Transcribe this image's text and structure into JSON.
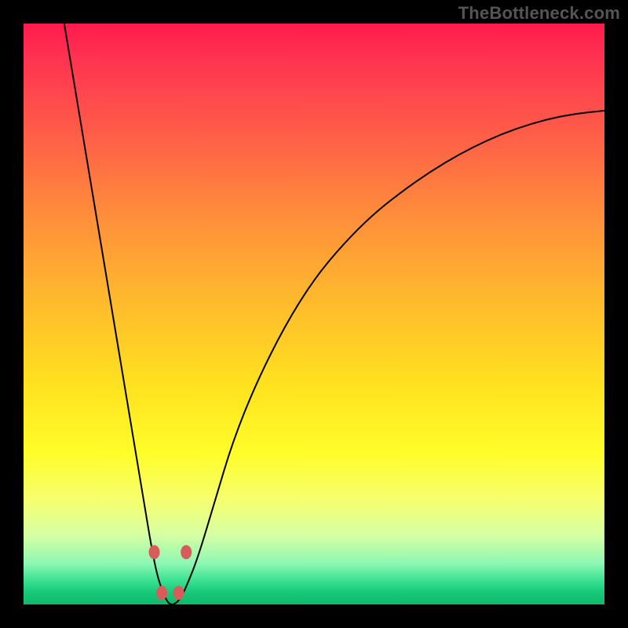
{
  "watermark": "TheBottleneck.com",
  "colors": {
    "frame": "#000000",
    "watermark": "#555555",
    "curve": "#000000",
    "dot": "#d95c5c",
    "gradient_top": "#ff1a4d",
    "gradient_bottom": "#11b86c"
  },
  "chart_data": {
    "type": "line",
    "title": "",
    "xlabel": "",
    "ylabel": "",
    "xlim": [
      0,
      100
    ],
    "ylim": [
      0,
      100
    ],
    "grid": false,
    "legend": false,
    "series": [
      {
        "name": "bottleneck-curve",
        "x": [
          7,
          10,
          13,
          15,
          17,
          19,
          20,
          21,
          22,
          23,
          24,
          25,
          26,
          27,
          28,
          30,
          33,
          36,
          40,
          45,
          50,
          55,
          60,
          65,
          70,
          75,
          80,
          85,
          90,
          95,
          100
        ],
        "y": [
          100,
          82,
          64,
          52,
          40,
          28,
          22,
          16,
          10,
          5,
          2,
          0,
          0,
          1,
          3,
          8,
          18,
          28,
          38,
          48,
          56,
          62,
          67,
          71,
          74.5,
          77.5,
          80,
          82,
          83.5,
          84.5,
          85
        ]
      }
    ],
    "annotations": [
      {
        "type": "dot",
        "x": 22.5,
        "y": 9
      },
      {
        "type": "dot",
        "x": 23.8,
        "y": 2
      },
      {
        "type": "dot",
        "x": 26.7,
        "y": 2
      },
      {
        "type": "dot",
        "x": 28.0,
        "y": 9
      }
    ]
  }
}
